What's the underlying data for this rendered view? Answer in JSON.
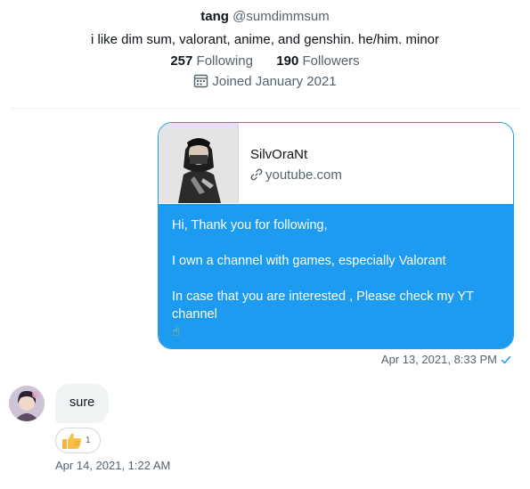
{
  "profile": {
    "name": "tang",
    "handle": "@sumdimmsum",
    "bio": "i like dim sum, valorant, anime, and genshin. he/him. minor",
    "following_count": "257",
    "following_label": "Following",
    "followers_count": "190",
    "followers_label": "Followers",
    "joined": "Joined January 2021",
    "joined_icon": "calendar-icon"
  },
  "outgoing_message": {
    "preview": {
      "title": "SilvOraNt",
      "domain": "youtube.com",
      "domain_icon": "link-icon"
    },
    "lines": [
      "Hi, Thank you for following,",
      "I own a channel with games,  especially Valorant",
      "In case that you are interested , Please check  my YT channel",
      "☝"
    ],
    "timestamp": "Apr 13, 2021, 8:33 PM",
    "status_icon": "check-icon"
  },
  "incoming_message": {
    "text": "sure",
    "reaction": {
      "emoji": "👍",
      "count": "1"
    },
    "timestamp": "Apr 14, 2021, 1:22 AM"
  },
  "colors": {
    "accent": "#1d9bf0",
    "text": "#0f1419",
    "muted": "#536471",
    "bubble_in": "#eff3f4"
  }
}
